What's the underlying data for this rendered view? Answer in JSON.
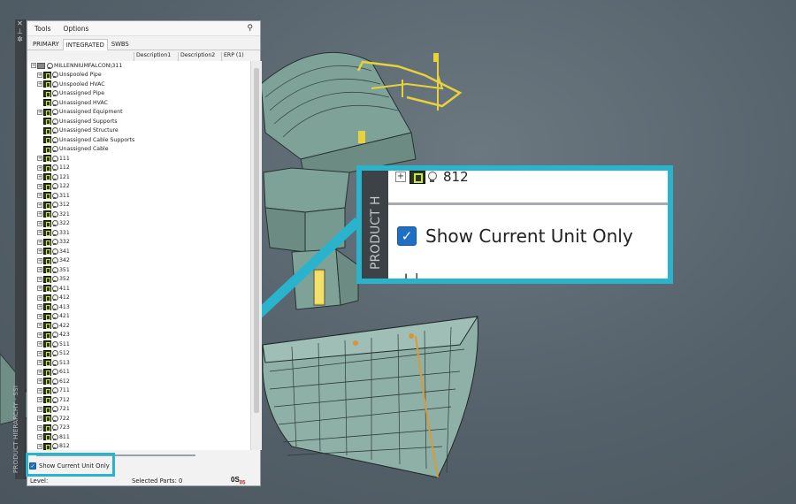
{
  "app": {
    "side_strip": {
      "title": "PRODUCT HIERARCHY - SSI",
      "icons": [
        "pin-icon",
        "close-icon",
        "gear-icon"
      ]
    },
    "menu": {
      "tools": "Tools",
      "options": "Options",
      "pin_icon": "pin-icon"
    },
    "tabs": [
      "PRIMARY",
      "INTEGRATED",
      "SWBS"
    ],
    "active_tab": "INTEGRATED",
    "columns": [
      "Description1",
      "Description2",
      "ERP (1)"
    ],
    "tree": {
      "root": "MILLENNIUMFALCON\\311",
      "unassigned": [
        {
          "label": "Unspooled Pipe",
          "expandable": true
        },
        {
          "label": "Unspooled HVAC",
          "expandable": true
        },
        {
          "label": "Unassigned Pipe",
          "expandable": false
        },
        {
          "label": "Unassigned HVAC",
          "expandable": false
        },
        {
          "label": "Unassigned Equipment",
          "expandable": true
        },
        {
          "label": "Unassigned Supports",
          "expandable": false
        },
        {
          "label": "Unassigned Structure",
          "expandable": false
        },
        {
          "label": "Unassigned Cable Supports",
          "expandable": false
        },
        {
          "label": "Unassigned Cable",
          "expandable": false
        }
      ],
      "units": [
        "111",
        "112",
        "121",
        "122",
        "311",
        "312",
        "321",
        "322",
        "331",
        "332",
        "341",
        "342",
        "351",
        "352",
        "411",
        "412",
        "413",
        "421",
        "422",
        "423",
        "511",
        "512",
        "513",
        "611",
        "612",
        "711",
        "712",
        "721",
        "722",
        "723",
        "811",
        "812"
      ]
    },
    "show_current_unit_only": {
      "label": "Show Current Unit Only",
      "checked": true
    },
    "status": {
      "level": "Level:",
      "selected": "Selected Parts: 0",
      "logo": "0S",
      "logo_sub": "05"
    }
  },
  "zoom_callout": {
    "row_label": "812",
    "side_label": "PRODUCT H",
    "checkbox_label": "Show Current Unit Only",
    "cut_text": "L   l"
  },
  "colors": {
    "accent": "#29b3cc",
    "checkbox": "#1f6fc5",
    "model": "#6f9a90"
  }
}
